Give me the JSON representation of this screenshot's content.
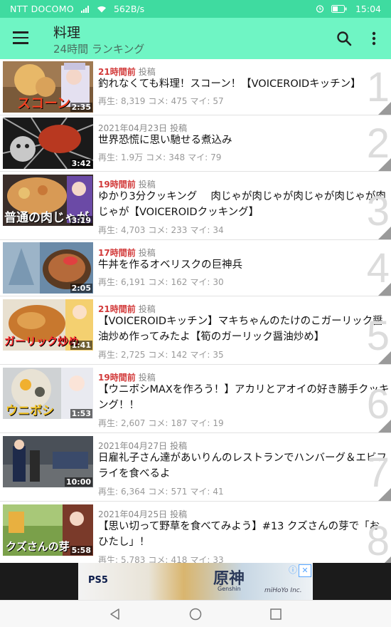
{
  "status_bar": {
    "carrier": "NTT DOCOMO",
    "speed": "562B/s",
    "time": "15:04",
    "icons": [
      "signal-icon",
      "wifi-icon",
      "alarm-icon",
      "battery-icon"
    ]
  },
  "app_bar": {
    "title": "料理",
    "subtitle": "24時間 ランキング",
    "icons": [
      "menu-icon",
      "search-icon",
      "more-vert-icon"
    ]
  },
  "labels": {
    "posted": "投稿",
    "views": "再生:",
    "comments": "コメ:",
    "mylists": "マイ:"
  },
  "videos": [
    {
      "rank": "1",
      "ago": "21時間前",
      "date": "",
      "title": "釣れなくても料理！スコーン！【VOICEROIDキッチン】",
      "views": "8,319",
      "comments": "475",
      "mylists": "57",
      "duration": "2:35",
      "thumb_text": "スコーン"
    },
    {
      "rank": "2",
      "ago": "",
      "date": "2021年04月23日",
      "title": "世界恐慌に思い馳せる煮込み",
      "views": "1.9万",
      "comments": "348",
      "mylists": "79",
      "duration": "3:42",
      "thumb_text": ""
    },
    {
      "rank": "3",
      "ago": "19時間前",
      "date": "",
      "title": "ゆかり3分クッキング　 肉じゃが肉じゃが肉じゃが肉じゃが肉じゃが【VOICEROIDクッキング】",
      "views": "4,703",
      "comments": "233",
      "mylists": "34",
      "duration": "3:19",
      "thumb_text": "普通の肉じゃが"
    },
    {
      "rank": "4",
      "ago": "17時間前",
      "date": "",
      "title": "牛丼を作るオベリスクの巨神兵",
      "views": "6,191",
      "comments": "162",
      "mylists": "30",
      "duration": "2:05",
      "thumb_text": ""
    },
    {
      "rank": "5",
      "ago": "21時間前",
      "date": "",
      "title": "【VOICEROIDキッチン】マキちゃんのたけのこガーリック醤油炒め作ってみたよ【筍のガーリック醤油炒め】",
      "views": "2,725",
      "comments": "142",
      "mylists": "35",
      "duration": "1:41",
      "thumb_text": "ガーリック炒め"
    },
    {
      "rank": "6",
      "ago": "19時間前",
      "date": "",
      "title": "【ウニボシMAXを作ろう！】アカリとアオイの好き勝手クッキング！！",
      "views": "2,607",
      "comments": "187",
      "mylists": "19",
      "duration": "1:53",
      "thumb_text": "ウニボシ"
    },
    {
      "rank": "7",
      "ago": "",
      "date": "2021年04月27日",
      "title": "日雇礼子さん達があいりんのレストランでハンバーグ＆エビフライを食べるよ",
      "views": "6,364",
      "comments": "571",
      "mylists": "41",
      "duration": "10:00",
      "thumb_text": ""
    },
    {
      "rank": "8",
      "ago": "",
      "date": "2021年04月25日",
      "title": "【思い切って野草を食べてみよう】#13 クズさんの芽で「おひたし」！",
      "views": "5,783",
      "comments": "418",
      "mylists": "33",
      "duration": "5:58",
      "thumb_text": "クズさんの芽"
    }
  ],
  "ad": {
    "brand_left": "PS5",
    "brand_main": "原神",
    "brand_sub": "Genshin",
    "publisher": "miHoYo Inc."
  },
  "navigation_bar": {
    "icons": [
      "back-icon",
      "home-icon",
      "recents-icon"
    ]
  },
  "colors": {
    "status_bar": "#3fdba0",
    "app_bar": "#6ff5c4",
    "ago_red": "#d23a3a"
  }
}
